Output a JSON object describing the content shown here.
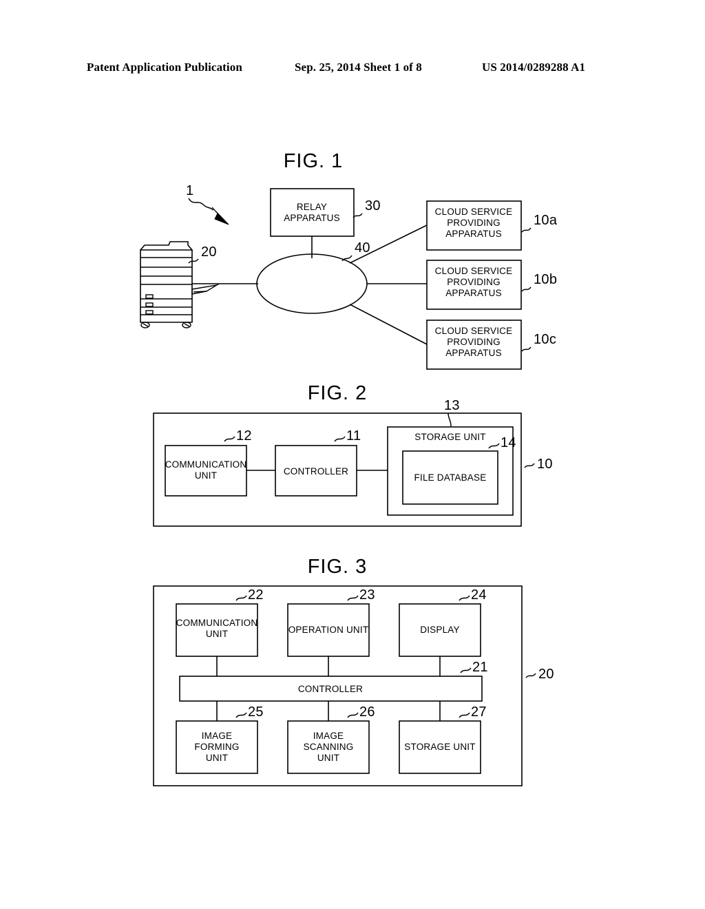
{
  "header": {
    "left": "Patent Application Publication",
    "middle": "Sep. 25, 2014  Sheet 1 of 8",
    "right": "US 2014/0289288 A1"
  },
  "figures": [
    {
      "title": "FIG. 1",
      "system_ref": "1",
      "nodes": {
        "mfp_ref": "20",
        "relay": {
          "label_line1": "RELAY",
          "label_line2": "APPARATUS",
          "ref": "30"
        },
        "network_ref": "40",
        "clouds": [
          {
            "line1": "CLOUD SERVICE",
            "line2": "PROVIDING",
            "line3": "APPARATUS",
            "ref": "10a"
          },
          {
            "line1": "CLOUD SERVICE",
            "line2": "PROVIDING",
            "line3": "APPARATUS",
            "ref": "10b"
          },
          {
            "line1": "CLOUD SERVICE",
            "line2": "PROVIDING",
            "line3": "APPARATUS",
            "ref": "10c"
          }
        ]
      }
    },
    {
      "title": "FIG. 2",
      "outer_ref": "10",
      "blocks": [
        {
          "line1": "COMMUNICATION",
          "line2": "UNIT",
          "ref": "12"
        },
        {
          "line1": "CONTROLLER",
          "line2": "",
          "ref": "11"
        },
        {
          "line1": "STORAGE UNIT",
          "line2": "",
          "ref": "13"
        },
        {
          "line1": "FILE DATABASE",
          "line2": "",
          "ref": "14"
        }
      ]
    },
    {
      "title": "FIG. 3",
      "outer_ref": "20",
      "blocks": [
        {
          "line1": "COMMUNICATION",
          "line2": "UNIT",
          "line3": "",
          "ref": "22"
        },
        {
          "line1": "OPERATION UNIT",
          "line2": "",
          "line3": "",
          "ref": "23"
        },
        {
          "line1": "DISPLAY",
          "line2": "",
          "line3": "",
          "ref": "24"
        },
        {
          "line1": "CONTROLLER",
          "line2": "",
          "line3": "",
          "ref": "21"
        },
        {
          "line1": "IMAGE",
          "line2": "FORMING",
          "line3": "UNIT",
          "ref": "25"
        },
        {
          "line1": "IMAGE",
          "line2": "SCANNING",
          "line3": "UNIT",
          "ref": "26"
        },
        {
          "line1": "STORAGE UNIT",
          "line2": "",
          "line3": "",
          "ref": "27"
        }
      ]
    }
  ],
  "colors": {
    "ink": "#000000",
    "paper": "#ffffff"
  }
}
